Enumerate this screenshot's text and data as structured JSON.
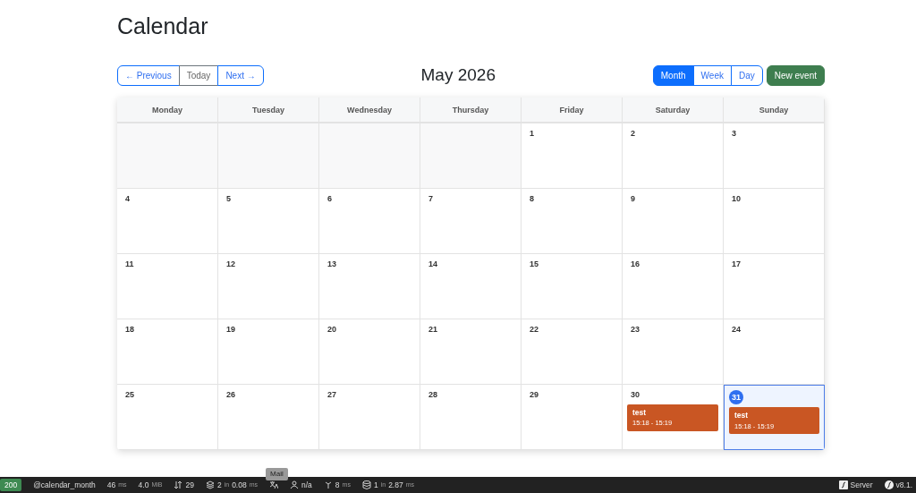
{
  "page_title": "Calendar",
  "nav_buttons": [
    {
      "label": "← Previous",
      "kind": "link"
    },
    {
      "label": "Today",
      "kind": "plain"
    },
    {
      "label": "Next →",
      "kind": "link"
    }
  ],
  "period_title": "May 2026",
  "view_tabs": [
    {
      "label": "Month",
      "selected": true
    },
    {
      "label": "Week",
      "selected": false
    },
    {
      "label": "Day",
      "selected": false
    }
  ],
  "new_event_button": "New event",
  "weekdays": [
    "Monday",
    "Tuesday",
    "Wednesday",
    "Thursday",
    "Friday",
    "Saturday",
    "Sunday"
  ],
  "weeks": [
    [
      {
        "outside": true
      },
      {
        "outside": true
      },
      {
        "outside": true
      },
      {
        "outside": true
      },
      {
        "label": "1",
        "outside": false,
        "today": false
      },
      {
        "label": "2",
        "outside": false,
        "today": false
      },
      {
        "label": "3",
        "outside": false,
        "today": false
      }
    ],
    [
      {
        "label": "4",
        "outside": false,
        "today": false
      },
      {
        "label": "5",
        "outside": false,
        "today": false
      },
      {
        "label": "6",
        "outside": false,
        "today": false
      },
      {
        "label": "7",
        "outside": false,
        "today": false
      },
      {
        "label": "8",
        "outside": false,
        "today": false
      },
      {
        "label": "9",
        "outside": false,
        "today": false
      },
      {
        "label": "10",
        "outside": false,
        "today": false
      }
    ],
    [
      {
        "label": "11",
        "outside": false,
        "today": false
      },
      {
        "label": "12",
        "outside": false,
        "today": false
      },
      {
        "label": "13",
        "outside": false,
        "today": false
      },
      {
        "label": "14",
        "outside": false,
        "today": false
      },
      {
        "label": "15",
        "outside": false,
        "today": false
      },
      {
        "label": "16",
        "outside": false,
        "today": false
      },
      {
        "label": "17",
        "outside": false,
        "today": false
      }
    ],
    [
      {
        "label": "18",
        "outside": false,
        "today": false
      },
      {
        "label": "19",
        "outside": false,
        "today": false
      },
      {
        "label": "20",
        "outside": false,
        "today": false
      },
      {
        "label": "21",
        "outside": false,
        "today": false
      },
      {
        "label": "22",
        "outside": false,
        "today": false
      },
      {
        "label": "23",
        "outside": false,
        "today": false
      },
      {
        "label": "24",
        "outside": false,
        "today": false
      }
    ],
    [
      {
        "label": "25",
        "outside": false,
        "today": false
      },
      {
        "label": "26",
        "outside": false,
        "today": false
      },
      {
        "label": "27",
        "outside": false,
        "today": false
      },
      {
        "label": "28",
        "outside": false,
        "today": false
      },
      {
        "label": "29",
        "outside": false,
        "today": false
      },
      {
        "label": "30",
        "outside": false,
        "today": false,
        "events": [
          {
            "title": "test",
            "time": "15:18 - 15:19",
            "color": "#c95623"
          }
        ]
      },
      {
        "label": "31",
        "outside": false,
        "today": true,
        "events": [
          {
            "title": "test",
            "time": "15:18 - 15:19",
            "color": "#c95623"
          }
        ]
      }
    ]
  ],
  "status_bar": {
    "left": [
      {
        "kind": "status",
        "parts": [
          {
            "text": "200",
            "muted": false
          }
        ]
      },
      {
        "kind": "route",
        "parts": [
          {
            "text": "@calendar_month",
            "muted": false
          }
        ]
      },
      {
        "kind": "metric",
        "parts": [
          {
            "text": "46",
            "muted": false
          },
          {
            "text": "ms",
            "muted": true
          }
        ]
      },
      {
        "kind": "metric",
        "parts": [
          {
            "text": "4.0",
            "muted": false
          },
          {
            "text": "MiB",
            "muted": true
          }
        ]
      },
      {
        "kind": "metric",
        "parts": [
          {
            "text": "29",
            "muted": false
          }
        ]
      },
      {
        "kind": "metric",
        "parts": [
          {
            "text": "2",
            "muted": false
          },
          {
            "text": "in",
            "muted": true
          },
          {
            "text": "0.08",
            "muted": false
          },
          {
            "text": "ms",
            "muted": true
          }
        ]
      },
      {
        "kind": "metric",
        "tooltip": "Mail"
      },
      {
        "kind": "metric",
        "parts": [
          {
            "text": "n/a",
            "muted": false
          }
        ]
      },
      {
        "kind": "metric",
        "parts": [
          {
            "text": "8",
            "muted": false
          },
          {
            "text": "ms",
            "muted": true
          }
        ]
      },
      {
        "kind": "metric",
        "parts": [
          {
            "text": "1",
            "muted": false
          },
          {
            "text": "in",
            "muted": true
          },
          {
            "text": "2.87",
            "muted": false
          },
          {
            "text": "ms",
            "muted": true
          }
        ]
      }
    ],
    "right": [
      {
        "kind": "metric",
        "parts": [
          {
            "text": "Server",
            "muted": false
          }
        ]
      },
      {
        "kind": "metric",
        "parts": [
          {
            "text": "v8.1.",
            "muted": false
          }
        ]
      }
    ]
  }
}
